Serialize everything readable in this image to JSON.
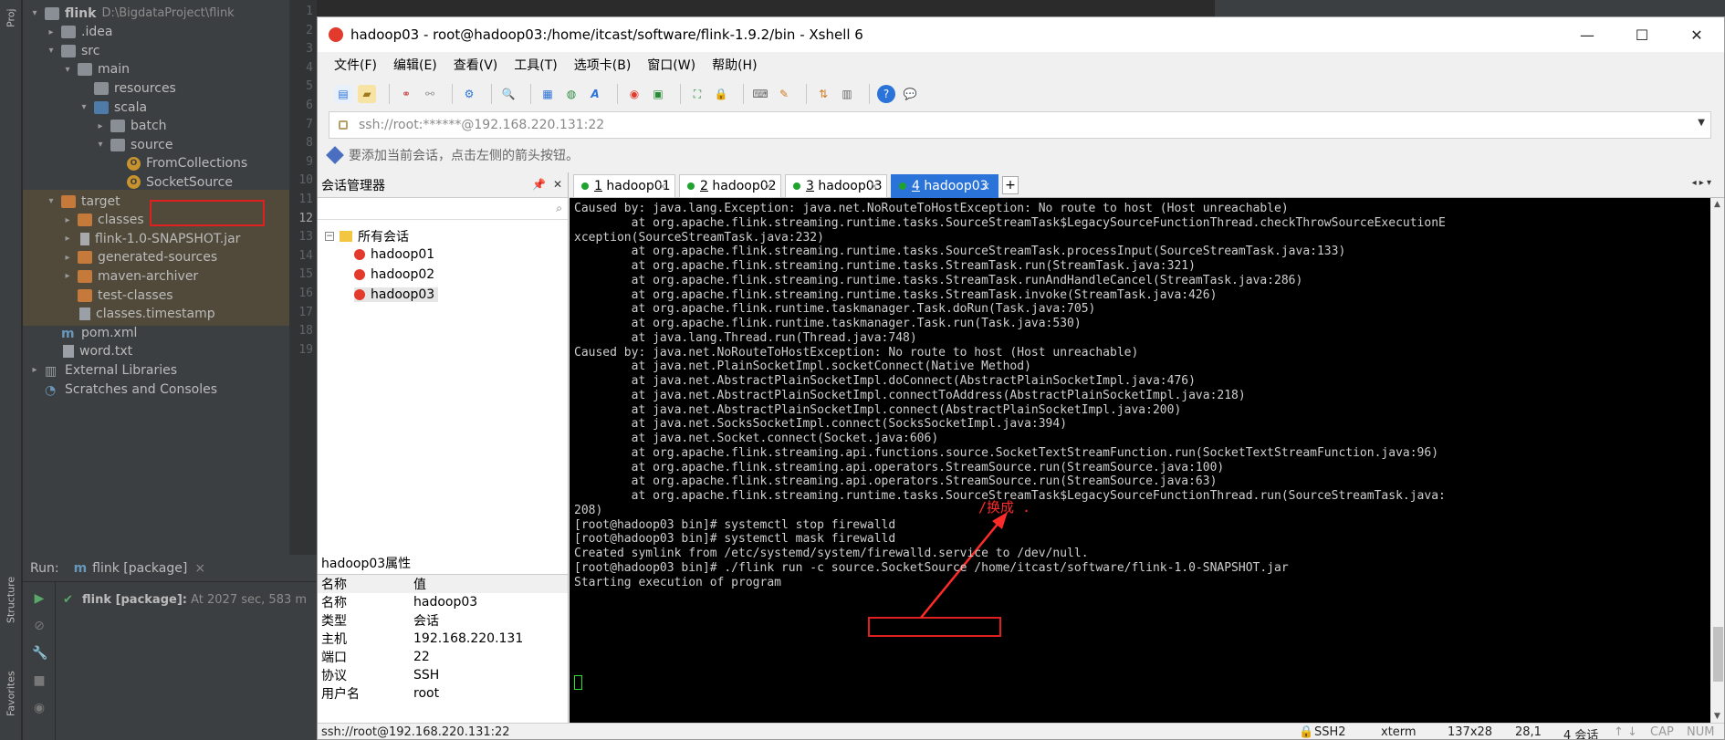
{
  "ide": {
    "strip_tabs": {
      "project": "Proj",
      "structure": "Structure",
      "favorites": "Favorites"
    },
    "tree": [
      {
        "label": "flink",
        "path": "D:\\BigdataProject\\flink",
        "type": "folder"
      },
      {
        "label": ".idea",
        "type": "folder"
      },
      {
        "label": "src",
        "type": "folder"
      },
      {
        "label": "main",
        "type": "folder"
      },
      {
        "label": "resources",
        "type": "folder"
      },
      {
        "label": "scala",
        "type": "folder-blue"
      },
      {
        "label": "batch",
        "type": "folder"
      },
      {
        "label": "source",
        "type": "folder"
      },
      {
        "label": "FromCollections",
        "type": "scala"
      },
      {
        "label": "SocketSource",
        "type": "scala"
      },
      {
        "label": "target",
        "type": "folder-orange"
      },
      {
        "label": "classes",
        "type": "folder-orange"
      },
      {
        "label": "flink-1.0-SNAPSHOT.jar",
        "type": "jar"
      },
      {
        "label": "generated-sources",
        "type": "folder-orange"
      },
      {
        "label": "maven-archiver",
        "type": "folder-orange"
      },
      {
        "label": "test-classes",
        "type": "folder-orange"
      },
      {
        "label": "classes.timestamp",
        "type": "file"
      },
      {
        "label": "pom.xml",
        "type": "maven"
      },
      {
        "label": "word.txt",
        "type": "file"
      },
      {
        "label": "External Libraries",
        "type": "lib"
      },
      {
        "label": "Scratches and Consoles",
        "type": "scratch"
      }
    ],
    "line_numbers": [
      "1",
      "2",
      "3",
      "4",
      "5",
      "6",
      "7",
      "8",
      "9",
      "10",
      "11",
      "12",
      "13",
      "14",
      "15",
      "16",
      "17",
      "18",
      "19"
    ],
    "run": {
      "label": "Run:",
      "tab": "flink [package]",
      "line_bold": "flink [package]:",
      "line_rest": "At 2027 sec, 583 m"
    }
  },
  "xshell": {
    "title": "hadoop03 - root@hadoop03:/home/itcast/software/flink-1.9.2/bin - Xshell 6",
    "menu": [
      "文件(F)",
      "编辑(E)",
      "查看(V)",
      "工具(T)",
      "选项卡(B)",
      "窗口(W)",
      "帮助(H)"
    ],
    "address": "ssh://root:******@192.168.220.131:22",
    "hint": "要添加当前会话，点击左侧的箭头按钮。",
    "session_manager": {
      "title": "会话管理器",
      "root": "所有会话",
      "sessions": [
        "hadoop01",
        "hadoop02",
        "hadoop03"
      ]
    },
    "properties": {
      "title": "hadoop03属性",
      "header": [
        "名称",
        "值"
      ],
      "rows": [
        [
          "名称",
          "hadoop03"
        ],
        [
          "类型",
          "会话"
        ],
        [
          "主机",
          "192.168.220.131"
        ],
        [
          "端口",
          "22"
        ],
        [
          "协议",
          "SSH"
        ],
        [
          "用户名",
          "root"
        ]
      ]
    },
    "tabs": [
      {
        "num": "1",
        "name": "hadoop01"
      },
      {
        "num": "2",
        "name": "hadoop02"
      },
      {
        "num": "3",
        "name": "hadoop03"
      },
      {
        "num": "4",
        "name": "hadoop03"
      }
    ],
    "terminal_lines": [
      "Caused by: java.lang.Exception: java.net.NoRouteToHostException: No route to host (Host unreachable)",
      "        at org.apache.flink.streaming.runtime.tasks.SourceStreamTask$LegacySourceFunctionThread.checkThrowSourceExecutionE",
      "xception(SourceStreamTask.java:232)",
      "        at org.apache.flink.streaming.runtime.tasks.SourceStreamTask.processInput(SourceStreamTask.java:133)",
      "        at org.apache.flink.streaming.runtime.tasks.StreamTask.run(StreamTask.java:321)",
      "        at org.apache.flink.streaming.runtime.tasks.StreamTask.runAndHandleCancel(StreamTask.java:286)",
      "        at org.apache.flink.streaming.runtime.tasks.StreamTask.invoke(StreamTask.java:426)",
      "        at org.apache.flink.runtime.taskmanager.Task.doRun(Task.java:705)",
      "        at org.apache.flink.runtime.taskmanager.Task.run(Task.java:530)",
      "        at java.lang.Thread.run(Thread.java:748)",
      "Caused by: java.net.NoRouteToHostException: No route to host (Host unreachable)",
      "        at java.net.PlainSocketImpl.socketConnect(Native Method)",
      "        at java.net.AbstractPlainSocketImpl.doConnect(AbstractPlainSocketImpl.java:476)",
      "        at java.net.AbstractPlainSocketImpl.connectToAddress(AbstractPlainSocketImpl.java:218)",
      "        at java.net.AbstractPlainSocketImpl.connect(AbstractPlainSocketImpl.java:200)",
      "        at java.net.SocksSocketImpl.connect(SocksSocketImpl.java:394)",
      "        at java.net.Socket.connect(Socket.java:606)",
      "        at org.apache.flink.streaming.api.functions.source.SocketTextStreamFunction.run(SocketTextStreamFunction.java:96)",
      "        at org.apache.flink.streaming.api.operators.StreamSource.run(StreamSource.java:100)",
      "        at org.apache.flink.streaming.api.operators.StreamSource.run(StreamSource.java:63)",
      "        at org.apache.flink.streaming.runtime.tasks.SourceStreamTask$LegacySourceFunctionThread.run(SourceStreamTask.java:",
      "208)",
      "[root@hadoop03 bin]# systemctl stop firewalld",
      "[root@hadoop03 bin]# systemctl mask firewalld",
      "Created symlink from /etc/systemd/system/firewalld.service to /dev/null.",
      "[root@hadoop03 bin]# ./flink run -c source.SocketSource /home/itcast/software/flink-1.0-SNAPSHOT.jar",
      "Starting execution of program"
    ],
    "annotation": "/换成 .",
    "status": {
      "connection": "ssh://root@192.168.220.131:22",
      "protocol": "SSH2",
      "terminal": "xterm",
      "size": "137x28",
      "cursor_pos": "28,1",
      "sessions": "4 会话",
      "caps": "CAP",
      "num": "NUM"
    }
  }
}
